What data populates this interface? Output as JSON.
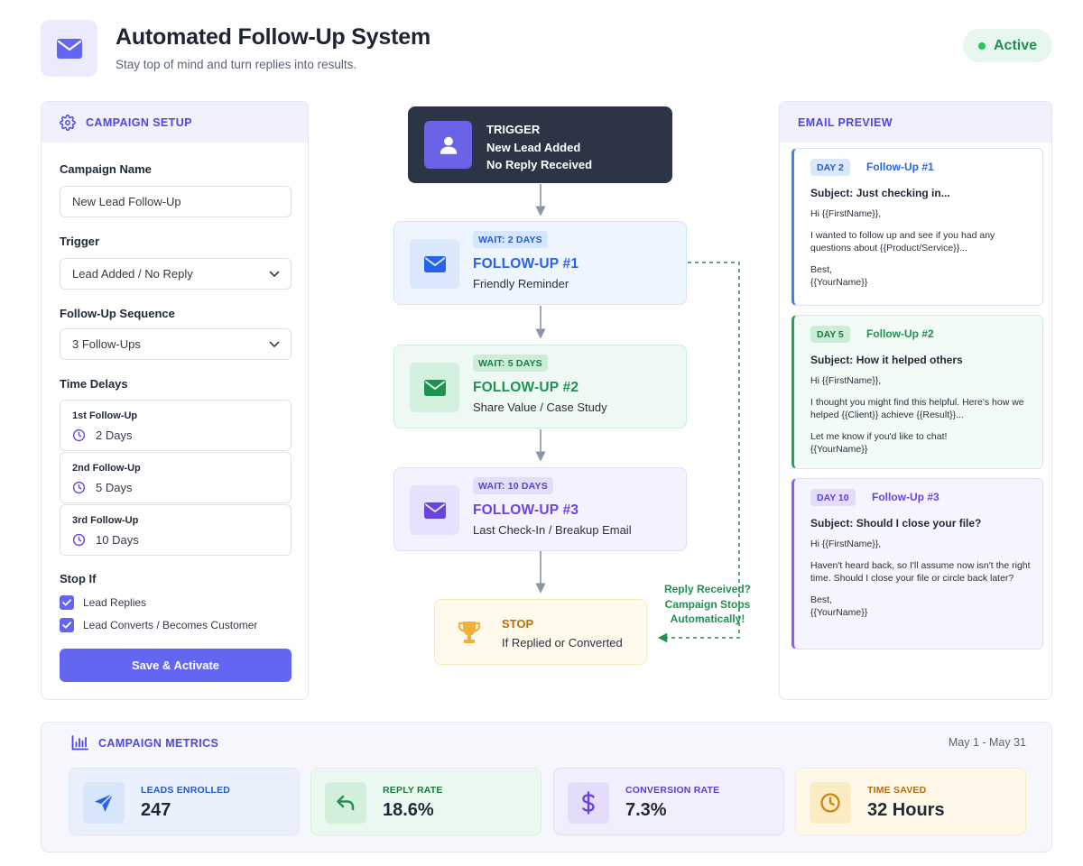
{
  "header": {
    "logo_icon": "envelope-icon",
    "title": "Automated Follow-Up System",
    "subtitle": "Stay top of mind and turn replies into results.",
    "status": "Active",
    "status_color": "#22c55e"
  },
  "setup": {
    "heading": "CAMPAIGN SETUP",
    "heading_icon": "gear-icon",
    "campaign_name_label": "Campaign Name",
    "campaign_name_value": "New Lead Follow-Up",
    "trigger_label": "Trigger",
    "trigger_value": "Lead Added / No Reply",
    "sequence_label": "Follow-Up Sequence",
    "sequence_value": "3 Follow-Ups",
    "delays_label": "Time Delays",
    "delays": [
      {
        "label": "1st Follow-Up",
        "value": "2 Days"
      },
      {
        "label": "2nd Follow-Up",
        "value": "5 Days"
      },
      {
        "label": "3rd Follow-Up",
        "value": "10 Days"
      }
    ],
    "stop_if_label": "Stop If",
    "stop_conditions": [
      {
        "label": "Lead Replies",
        "checked": true
      },
      {
        "label": "Lead Converts / Becomes Customer",
        "checked": true
      }
    ],
    "save_button": "Save & Activate",
    "accent_color": "#6366f1"
  },
  "flow": {
    "trigger": {
      "label": "TRIGGER",
      "line1": "New Lead Added",
      "line2": "No Reply Received",
      "icon": "user-icon"
    },
    "steps": [
      {
        "wait": "WAIT: 2 DAYS",
        "title": "FOLLOW-UP #1",
        "subtitle": "Friendly Reminder",
        "icon": "envelope-icon",
        "color": "#2563eb"
      },
      {
        "wait": "WAIT: 5 DAYS",
        "title": "FOLLOW-UP #2",
        "subtitle": "Share Value / Case Study",
        "icon": "envelope-icon",
        "color": "#1f9150"
      },
      {
        "wait": "WAIT: 10 DAYS",
        "title": "FOLLOW-UP #3",
        "subtitle": "Last Check-In / Breakup Email",
        "icon": "envelope-icon",
        "color": "#6a45db"
      }
    ],
    "stop": {
      "title": "STOP",
      "subtitle": "If Replied or Converted",
      "icon": "trophy-icon"
    },
    "reply_note": "Reply Received? Campaign Stops Automatically!"
  },
  "preview": {
    "heading": "EMAIL PREVIEW",
    "emails": [
      {
        "day": "DAY 2",
        "followup": "Follow-Up #1",
        "subject_label": "Subject:",
        "subject": "Just checking in...",
        "greeting": "Hi {{FirstName}},",
        "body": "I wanted to follow up and see if you had any questions about {{Product/Service}}...",
        "closing": "Best,",
        "signature": "{{YourName}}"
      },
      {
        "day": "DAY 5",
        "followup": "Follow-Up #2",
        "subject_label": "Subject:",
        "subject": "How it helped others",
        "greeting": "Hi {{FirstName}},",
        "body": "I thought you might find this helpful. Here's how we helped {{Client}} achieve {{Result}}...",
        "closing": "Let me know if you'd like to chat!",
        "signature": "{{YourName}}"
      },
      {
        "day": "DAY 10",
        "followup": "Follow-Up #3",
        "subject_label": "Subject:",
        "subject": "Should I close your file?",
        "greeting": "Hi {{FirstName}},",
        "body": "Haven't heard back, so I'll assume now isn't the right time. Should I close your file or circle back later?",
        "closing": "Best,",
        "signature": "{{YourName}}"
      }
    ]
  },
  "metrics": {
    "heading": "CAMPAIGN METRICS",
    "heading_icon": "bar-chart-icon",
    "date_range": "May 1 - May 31",
    "cards": [
      {
        "label": "LEADS ENROLLED",
        "value": "247",
        "icon": "send-icon"
      },
      {
        "label": "REPLY RATE",
        "value": "18.6%",
        "icon": "reply-icon"
      },
      {
        "label": "CONVERSION RATE",
        "value": "7.3%",
        "icon": "dollar-icon"
      },
      {
        "label": "TIME SAVED",
        "value": "32 Hours",
        "icon": "clock-icon"
      }
    ]
  }
}
